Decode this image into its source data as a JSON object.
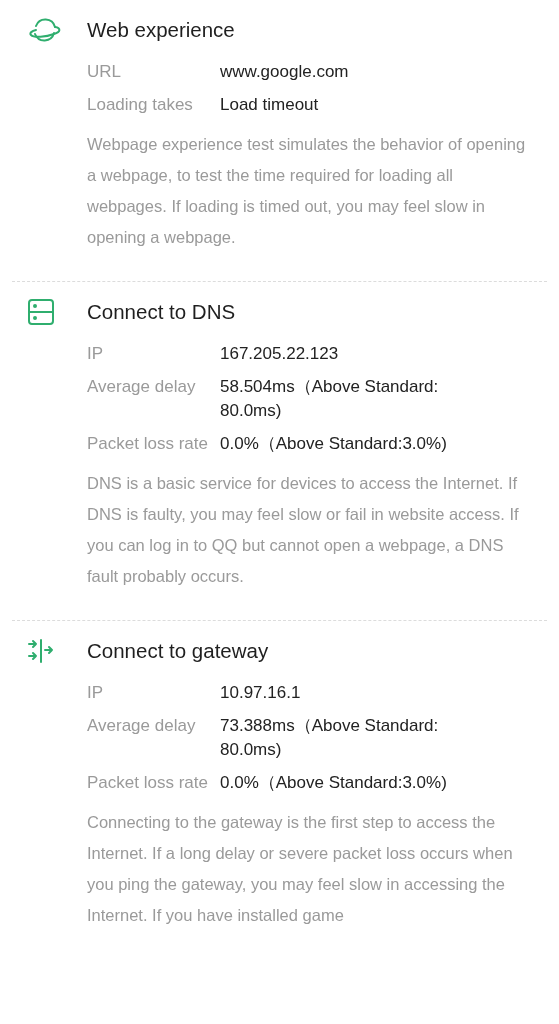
{
  "sections": [
    {
      "kind": "web",
      "title": "Web experience",
      "rows": [
        {
          "label": "URL",
          "value": "www.google.com"
        },
        {
          "label": "Loading takes",
          "value": "Load timeout"
        }
      ],
      "description": "Webpage experience test simulates the behavior of opening a webpage, to test the time required for loading all webpages. If loading is timed out, you may feel slow in opening a webpage."
    },
    {
      "kind": "dns",
      "title": "Connect to DNS",
      "rows": [
        {
          "label": "IP",
          "value": "167.205.22.123"
        },
        {
          "label": "Average delay",
          "value": "58.504ms（Above Standard: 80.0ms)"
        },
        {
          "label": "Packet loss rate",
          "value": "0.0%（Above Standard:3.0%)"
        }
      ],
      "description": "DNS is a basic service for devices to access the Internet. If DNS is faulty, you may feel slow or fail in website access. If you can log in to QQ but cannot open a webpage, a DNS fault probably occurs."
    },
    {
      "kind": "gateway",
      "title": "Connect to gateway",
      "rows": [
        {
          "label": "IP",
          "value": "10.97.16.1"
        },
        {
          "label": "Average delay",
          "value": "73.388ms（Above Standard: 80.0ms)"
        },
        {
          "label": "Packet loss rate",
          "value": "0.0%（Above Standard:3.0%)"
        }
      ],
      "description": "Connecting to the gateway is the first step to access the Internet. If a long delay or severe packet loss occurs when you ping the gateway, you may feel slow in accessing the Internet. If you have installed game"
    }
  ]
}
